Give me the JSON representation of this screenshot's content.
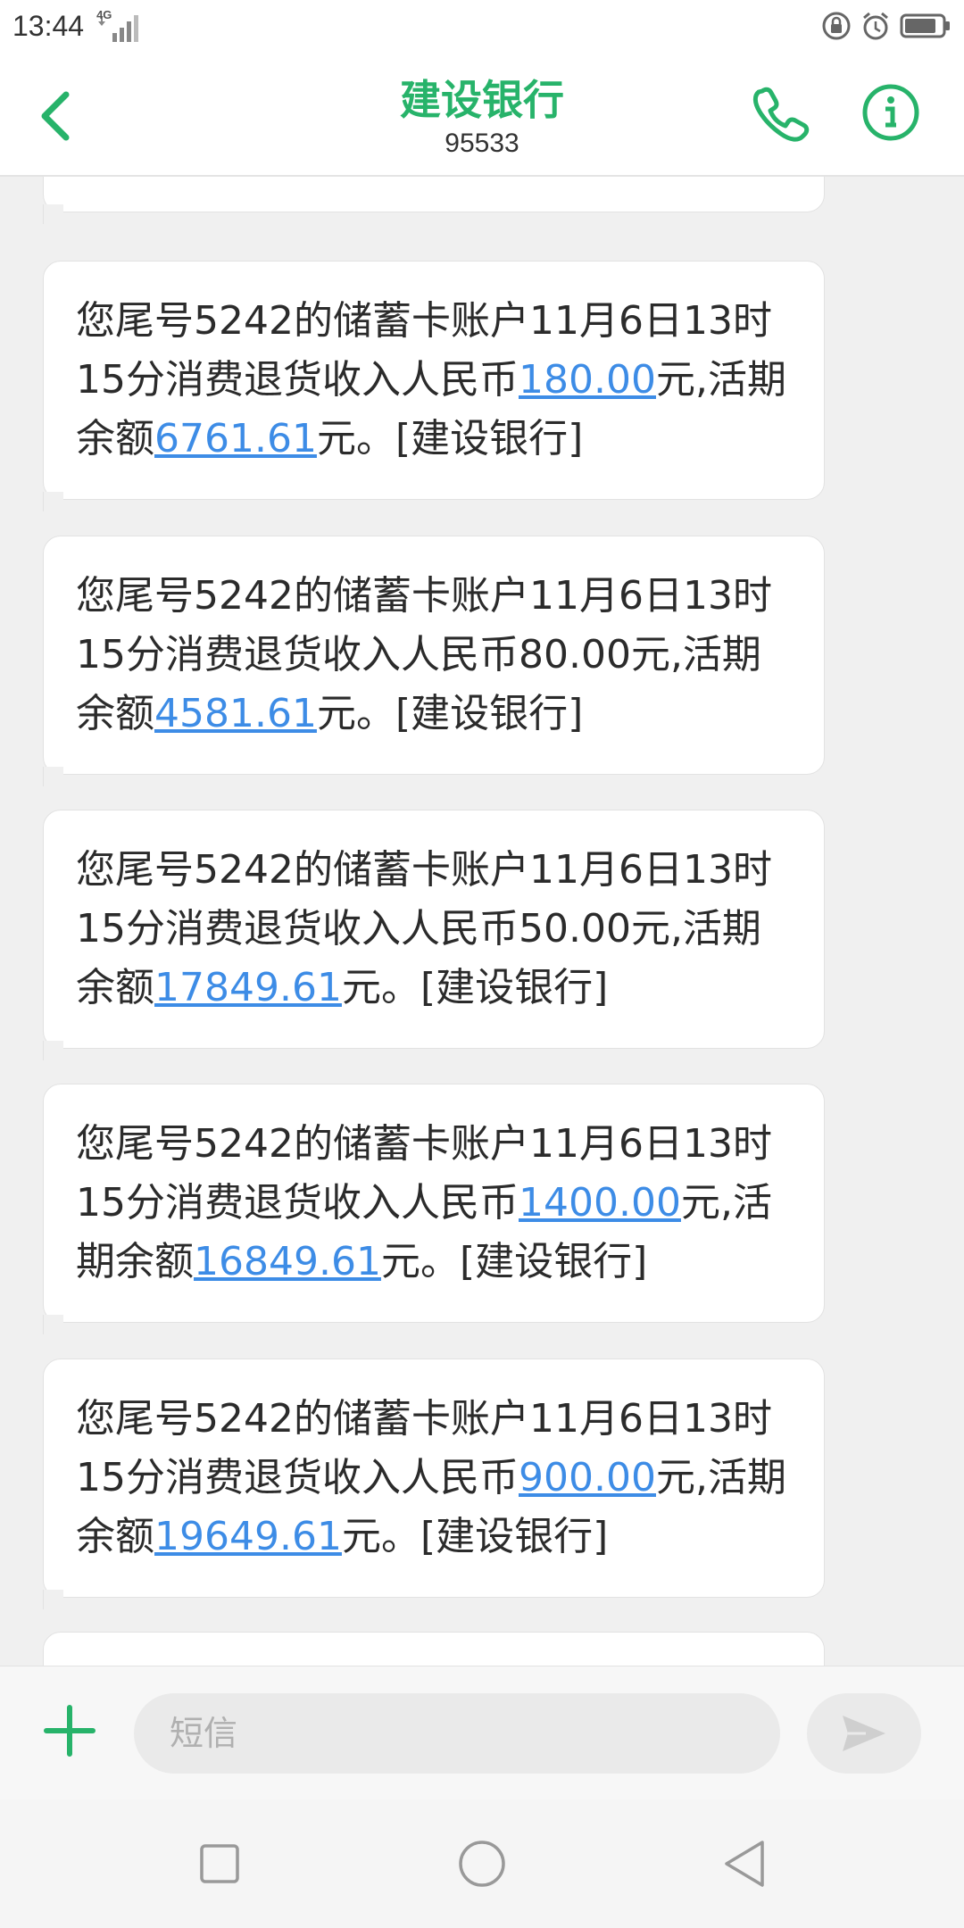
{
  "status_bar": {
    "time": "13:44",
    "network": "4G"
  },
  "header": {
    "title": "建设银行",
    "number": "95533"
  },
  "messages": [
    {
      "segments": [
        {
          "text": "您尾号5242的储蓄卡账户11月6日13时15分消费退货收入人民币"
        },
        {
          "text": "180.00",
          "link": true
        },
        {
          "text": "元,活期余额"
        },
        {
          "text": "6761.61",
          "link": true
        },
        {
          "text": "元。[建设银行]"
        }
      ]
    },
    {
      "segments": [
        {
          "text": "您尾号5242的储蓄卡账户11月6日13时15分消费退货收入人民币80.00元,活期余额"
        },
        {
          "text": "4581.61",
          "link": true
        },
        {
          "text": "元。[建设银行]"
        }
      ]
    },
    {
      "segments": [
        {
          "text": "您尾号5242的储蓄卡账户11月6日13时15分消费退货收入人民币50.00元,活期余额"
        },
        {
          "text": "17849.61",
          "link": true
        },
        {
          "text": "元。[建设银行]"
        }
      ]
    },
    {
      "segments": [
        {
          "text": "您尾号5242的储蓄卡账户11月6日13时15分消费退货收入人民币"
        },
        {
          "text": "1400.00",
          "link": true
        },
        {
          "text": "元,活期余额"
        },
        {
          "text": "16849.61",
          "link": true
        },
        {
          "text": "元。[建设银行]"
        }
      ]
    },
    {
      "segments": [
        {
          "text": "您尾号5242的储蓄卡账户11月6日13时15分消费退货收入人民币"
        },
        {
          "text": "900.00",
          "link": true
        },
        {
          "text": "元,活期余额"
        },
        {
          "text": "19649.61",
          "link": true
        },
        {
          "text": "元。[建设银行]"
        }
      ]
    }
  ],
  "composer": {
    "placeholder": "短信"
  },
  "colors": {
    "accent": "#27b36a",
    "link": "#3d8ce6"
  },
  "icons": {
    "back": "chevron-left-icon",
    "call": "phone-icon",
    "info": "info-icon",
    "add": "plus-icon",
    "send": "send-icon",
    "nav_recents": "square-icon",
    "nav_home": "circle-icon",
    "nav_back": "triangle-back-icon"
  }
}
